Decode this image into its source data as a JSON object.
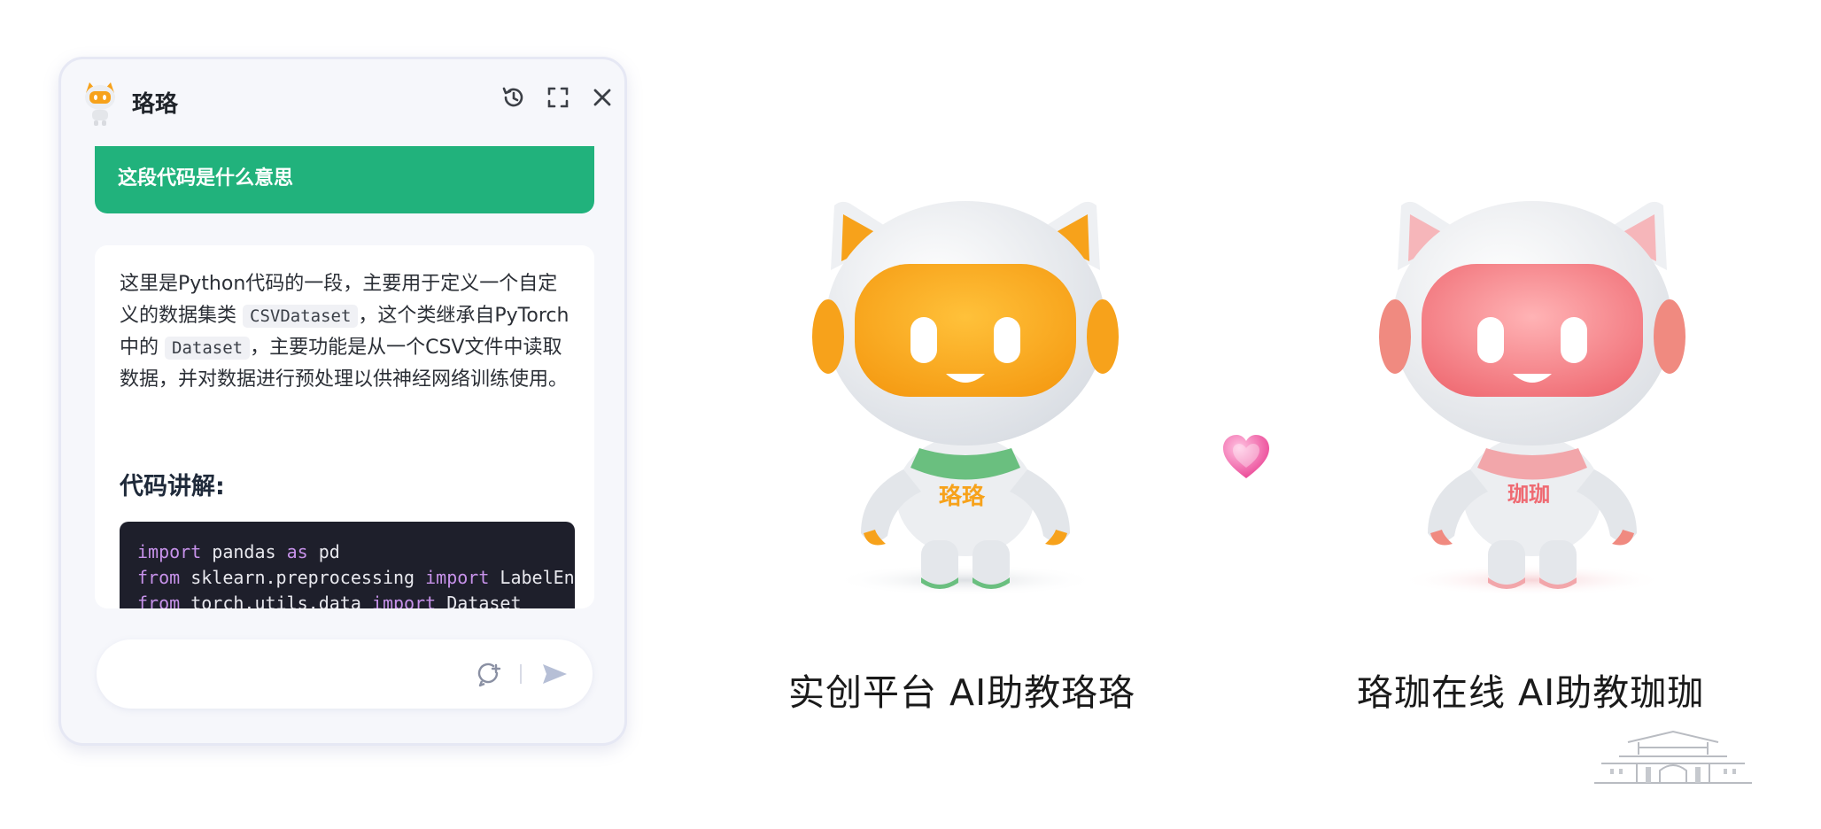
{
  "chat": {
    "title": "珞珞",
    "header_icons": [
      "history-icon",
      "fullscreen-icon",
      "close-icon"
    ],
    "user_message": "这段代码是什么意思",
    "answer": {
      "part1": "这里是Python代码的一段，主要用于定义一个自定义的数据集类 ",
      "code1": "CSVDataset",
      "part2": "，这个类继承自PyTorch中的 ",
      "code2": "Dataset",
      "part3": "，主要功能是从一个CSV文件中读取数据，并对数据进行预处理以供神经网络训练使用。"
    },
    "section_heading": "代码讲解:",
    "code_lines": [
      {
        "kw1": "import",
        "t1": " pandas ",
        "kw2": "as",
        "t2": " pd"
      },
      {
        "kw1": "from",
        "t1": " sklearn.preprocessing ",
        "kw2": "import",
        "t2": " LabelEncoder"
      },
      {
        "kw1": "from",
        "t1": " torch.utils.data ",
        "kw2": "import",
        "t2": " Dataset"
      }
    ],
    "input_placeholder": "",
    "input_icons": [
      "new-chat-icon",
      "send-icon"
    ]
  },
  "robots": {
    "left_caption": "实创平台 AI助教珞珞",
    "left_badge": "珞珞",
    "right_caption": "珞珈在线 AI助教珈珈",
    "right_badge": "珈珈"
  },
  "colors": {
    "accent_green": "#21b27c",
    "robot_orange": "#f7a21b",
    "robot_pink": "#f06c72",
    "code_bg": "#1e1f2b",
    "heart": "#ef4f9a"
  }
}
